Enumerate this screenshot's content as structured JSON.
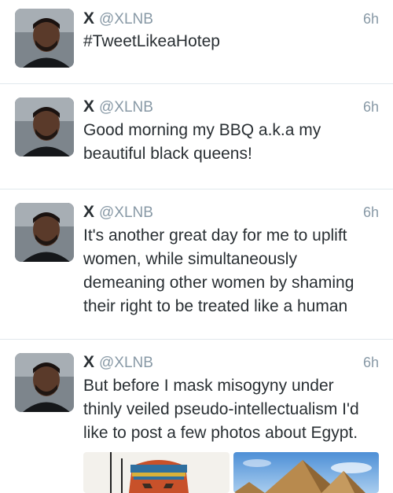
{
  "tweets": [
    {
      "name": "X",
      "handle": "@XLNB",
      "time": "6h",
      "text": "#TweetLikeaHotep"
    },
    {
      "name": "X",
      "handle": "@XLNB",
      "time": "6h",
      "text": "Good morning my BBQ a.k.a my\nbeautiful black queens!"
    },
    {
      "name": "X",
      "handle": "@XLNB",
      "time": "6h",
      "text": "It's another great day for me to uplift\nwomen, while simultaneously\ndemeaning other women by shaming\ntheir right to be treated like a human"
    },
    {
      "name": "X",
      "handle": "@XLNB",
      "time": "6h",
      "text": "But before I mask  misogyny under\nthinly veiled pseudo-intellectualism I'd\nlike to post a few photos about Egypt."
    }
  ],
  "media": [
    {
      "icon": "egyptian-figure-image"
    },
    {
      "icon": "pyramids-image"
    }
  ]
}
